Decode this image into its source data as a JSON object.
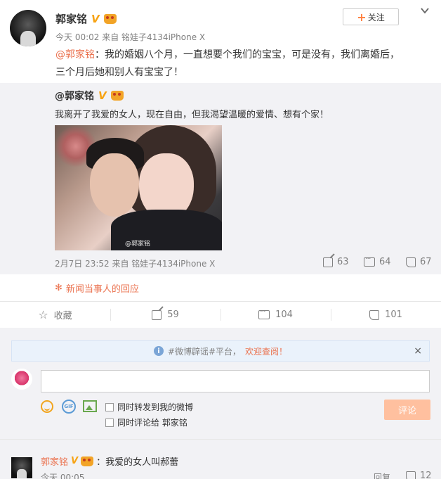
{
  "post": {
    "author": "郭家铭",
    "verified_badge": "V",
    "meta": "今天 00:02 来自 铭娃子4134iPhone X",
    "follow_label": "关注",
    "mention": "@郭家铭",
    "text_line1": "：我的婚姻八个月，一直想要个我们的宝宝，可是没有，我们离婚后，",
    "text_line2": "三个月后她和别人有宝宝了！"
  },
  "repost": {
    "author": "@郭家铭",
    "verified_badge": "V",
    "text": "我离开了我爱的女人，现在自由，但我渴望温暖的爱情、想有个家！",
    "photo_watermark": "@郭家铭",
    "meta": "2月7日 23:52 来自 铭娃子4134iPhone X",
    "shares": "63",
    "comments": "64",
    "likes": "67"
  },
  "topic_link": "新闻当事人的回应",
  "actions": {
    "favorite_label": "收藏",
    "shares": "59",
    "comments": "104",
    "likes": "101"
  },
  "notice": {
    "prefix": "#微博辟谣#平台，",
    "link": "欢迎查阅！",
    "close": "×"
  },
  "comment_box": {
    "sync_repost_label": "同时转发到我的微博",
    "sync_comment_label": "同时评论给 郭家铭",
    "submit_label": "评论",
    "gif_label": "GIF"
  },
  "comment": {
    "author": "郭家铭",
    "verified_badge": "V",
    "text": "：我爱的女人叫郝蕾",
    "meta": "今天 00:05",
    "reply_label": "回复",
    "likes": "12"
  },
  "colors": {
    "link": "#eb7350",
    "gray": "#808080",
    "repost_bg": "#f2f2f5",
    "submit_bg": "#ffc09f"
  }
}
